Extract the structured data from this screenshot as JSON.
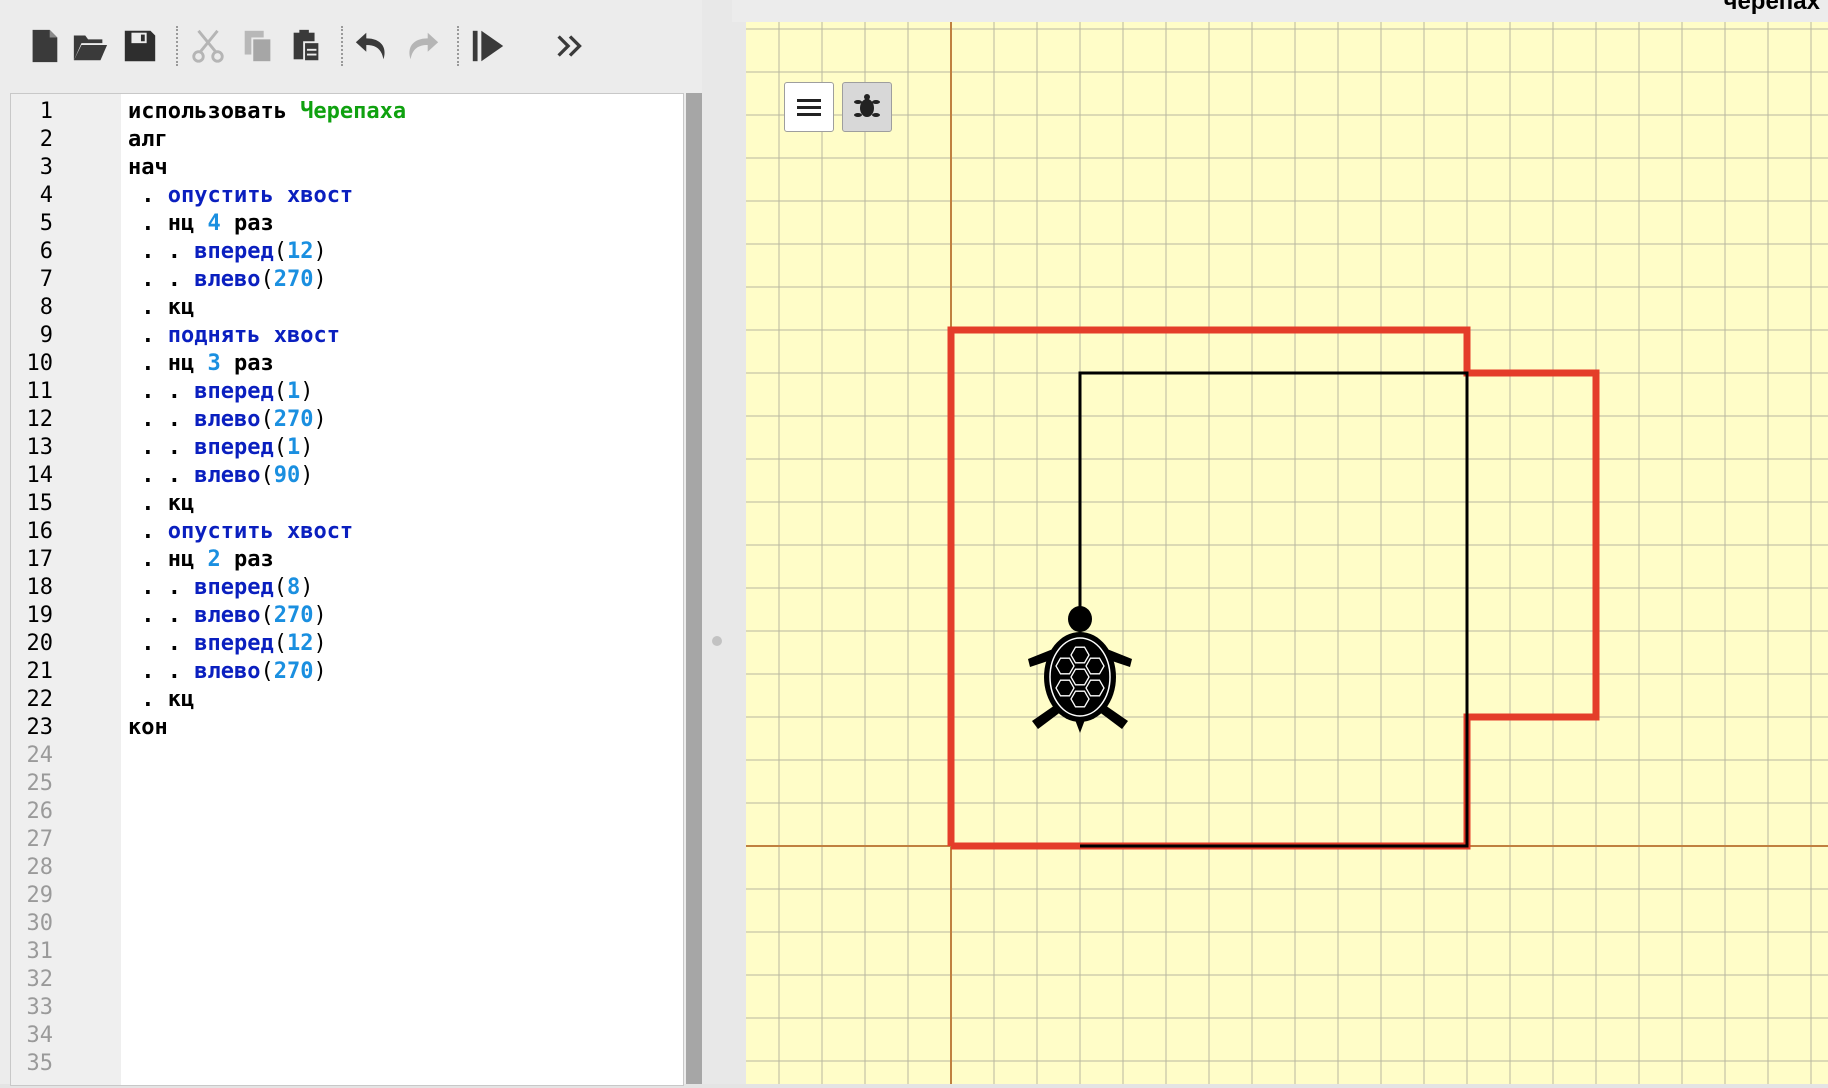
{
  "toolbar": {
    "icons": [
      "new-file-icon",
      "open-folder-icon",
      "save-icon",
      "cut-icon",
      "copy-icon",
      "paste-icon",
      "undo-icon",
      "redo-icon",
      "run-step-icon",
      "more-icon"
    ]
  },
  "editor": {
    "total_lines": 35,
    "code": [
      [
        {
          "t": "использовать ",
          "c": "kw"
        },
        {
          "t": "Черепаха",
          "c": "mod"
        }
      ],
      [
        {
          "t": "алг",
          "c": "kw"
        }
      ],
      [
        {
          "t": "нач",
          "c": "kw"
        }
      ],
      [
        {
          "t": " . ",
          "c": "kw"
        },
        {
          "t": "опустить хвост",
          "c": "cmd"
        }
      ],
      [
        {
          "t": " . нц ",
          "c": "kw"
        },
        {
          "t": "4",
          "c": "num"
        },
        {
          "t": " раз",
          "c": "kw"
        }
      ],
      [
        {
          "t": " . . ",
          "c": "kw"
        },
        {
          "t": "вперед",
          "c": "cmd"
        },
        {
          "t": "(",
          "c": "punc"
        },
        {
          "t": "12",
          "c": "num"
        },
        {
          "t": ")",
          "c": "punc"
        }
      ],
      [
        {
          "t": " . . ",
          "c": "kw"
        },
        {
          "t": "влево",
          "c": "cmd"
        },
        {
          "t": "(",
          "c": "punc"
        },
        {
          "t": "270",
          "c": "num"
        },
        {
          "t": ")",
          "c": "punc"
        }
      ],
      [
        {
          "t": " . кц",
          "c": "kw"
        }
      ],
      [
        {
          "t": " . ",
          "c": "kw"
        },
        {
          "t": "поднять хвост",
          "c": "cmd"
        }
      ],
      [
        {
          "t": " . нц ",
          "c": "kw"
        },
        {
          "t": "3",
          "c": "num"
        },
        {
          "t": " раз",
          "c": "kw"
        }
      ],
      [
        {
          "t": " . . ",
          "c": "kw"
        },
        {
          "t": "вперед",
          "c": "cmd"
        },
        {
          "t": "(",
          "c": "punc"
        },
        {
          "t": "1",
          "c": "num"
        },
        {
          "t": ")",
          "c": "punc"
        }
      ],
      [
        {
          "t": " . . ",
          "c": "kw"
        },
        {
          "t": "влево",
          "c": "cmd"
        },
        {
          "t": "(",
          "c": "punc"
        },
        {
          "t": "270",
          "c": "num"
        },
        {
          "t": ")",
          "c": "punc"
        }
      ],
      [
        {
          "t": " . . ",
          "c": "kw"
        },
        {
          "t": "вперед",
          "c": "cmd"
        },
        {
          "t": "(",
          "c": "punc"
        },
        {
          "t": "1",
          "c": "num"
        },
        {
          "t": ")",
          "c": "punc"
        }
      ],
      [
        {
          "t": " . . ",
          "c": "kw"
        },
        {
          "t": "влево",
          "c": "cmd"
        },
        {
          "t": "(",
          "c": "punc"
        },
        {
          "t": "90",
          "c": "num"
        },
        {
          "t": ")",
          "c": "punc"
        }
      ],
      [
        {
          "t": " . кц",
          "c": "kw"
        }
      ],
      [
        {
          "t": " . ",
          "c": "kw"
        },
        {
          "t": "опустить хвост",
          "c": "cmd"
        }
      ],
      [
        {
          "t": " . нц ",
          "c": "kw"
        },
        {
          "t": "2",
          "c": "num"
        },
        {
          "t": " раз",
          "c": "kw"
        }
      ],
      [
        {
          "t": " . . ",
          "c": "kw"
        },
        {
          "t": "вперед",
          "c": "cmd"
        },
        {
          "t": "(",
          "c": "punc"
        },
        {
          "t": "8",
          "c": "num"
        },
        {
          "t": ")",
          "c": "punc"
        }
      ],
      [
        {
          "t": " . . ",
          "c": "kw"
        },
        {
          "t": "влево",
          "c": "cmd"
        },
        {
          "t": "(",
          "c": "punc"
        },
        {
          "t": "270",
          "c": "num"
        },
        {
          "t": ")",
          "c": "punc"
        }
      ],
      [
        {
          "t": " . . ",
          "c": "kw"
        },
        {
          "t": "вперед",
          "c": "cmd"
        },
        {
          "t": "(",
          "c": "punc"
        },
        {
          "t": "12",
          "c": "num"
        },
        {
          "t": ")",
          "c": "punc"
        }
      ],
      [
        {
          "t": " . . ",
          "c": "kw"
        },
        {
          "t": "влево",
          "c": "cmd"
        },
        {
          "t": "(",
          "c": "punc"
        },
        {
          "t": "270",
          "c": "num"
        },
        {
          "t": ")",
          "c": "punc"
        }
      ],
      [
        {
          "t": " . кц",
          "c": "kw"
        }
      ],
      [
        {
          "t": "кон",
          "c": "kw"
        }
      ]
    ]
  },
  "canvas": {
    "top_title": "черепах",
    "background_color": "#fffdc8",
    "grid_color": "#b8b8a0",
    "axis_color": "#c08040",
    "red_path_color": "#e43d2a",
    "turtle_path_color": "#000000",
    "controls": [
      "menu-icon",
      "turtle-icon"
    ],
    "red_figure": [
      [
        0,
        0
      ],
      [
        0,
        12
      ],
      [
        12,
        12
      ],
      [
        12,
        11
      ],
      [
        15,
        11
      ],
      [
        15,
        3
      ],
      [
        12,
        3
      ],
      [
        12,
        0
      ],
      [
        0,
        0
      ]
    ],
    "black_square": [
      [
        3,
        0
      ],
      [
        12,
        0
      ],
      [
        12,
        11
      ],
      [
        3,
        11
      ],
      [
        3,
        3
      ]
    ],
    "turtle": {
      "x": 3,
      "y": 3,
      "heading": 0
    }
  }
}
